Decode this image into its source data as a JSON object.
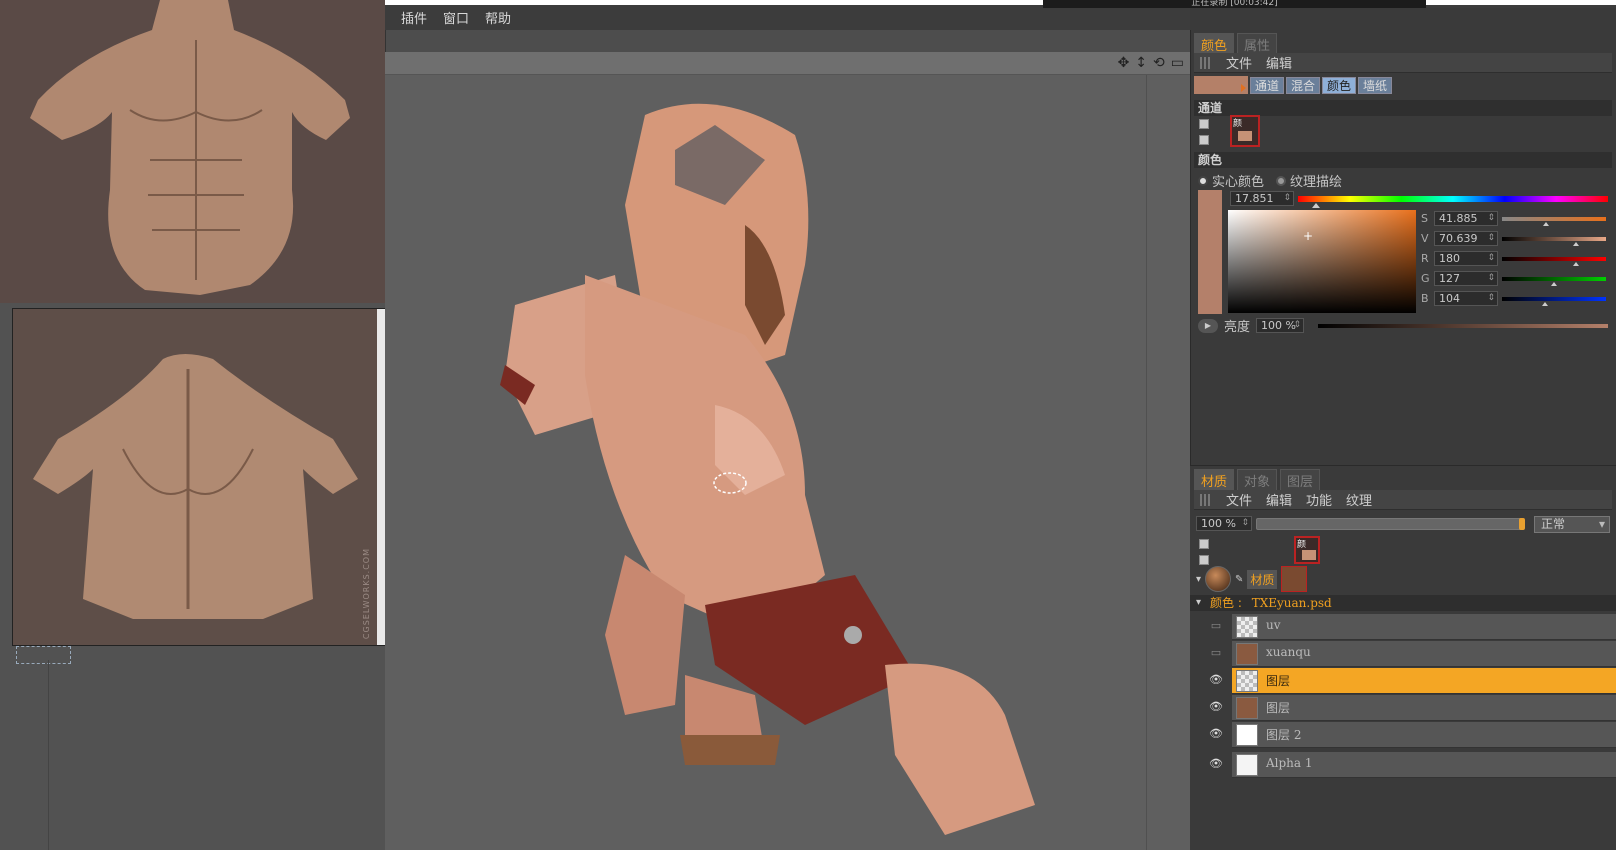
{
  "menu": {
    "items": [
      "插件",
      "窗口",
      "帮助"
    ]
  },
  "recording": {
    "text": "正在录制 [00:03:42]"
  },
  "reference": {
    "watermark": "CGSELWORKS.COM"
  },
  "right_panel": {
    "tabs": [
      "颜色",
      "属性"
    ],
    "menu": [
      "文件",
      "编辑"
    ],
    "modes": [
      "通道",
      "混合",
      "颜色",
      "墙纸"
    ],
    "channel_section": "通道",
    "channel_thumb_label": "颜",
    "color_section": "颜色",
    "radio_solid": "实心颜色",
    "radio_texture": "纹理描绘",
    "hue": "17.851",
    "sliders": [
      {
        "label": "S",
        "value": "41.885",
        "pos": 0.42,
        "gradient": "#888,#e8701c"
      },
      {
        "label": "V",
        "value": "70.639",
        "pos": 0.71,
        "gradient": "#000,#e8a888"
      },
      {
        "label": "R",
        "value": "180",
        "pos": 0.71,
        "gradient": "#000,#ff0000"
      },
      {
        "label": "G",
        "value": "127",
        "pos": 0.5,
        "gradient": "#000,#00d000"
      },
      {
        "label": "B",
        "value": "104",
        "pos": 0.41,
        "gradient": "#000,#0033ff"
      }
    ],
    "brightness_label": "亮度",
    "brightness_value": "100 %"
  },
  "material_panel": {
    "tabs": [
      "材质",
      "对象",
      "图层"
    ],
    "menu": [
      "文件",
      "编辑",
      "功能",
      "纹理"
    ],
    "opacity": "100 %",
    "blend_mode": "正常",
    "material_tag": "材质",
    "color_label": "颜色",
    "file_name": "TXEyuan.psd",
    "layers": [
      {
        "name": "uv",
        "visible": false,
        "selected": false,
        "thumb": "checker"
      },
      {
        "name": "xuanqu",
        "visible": false,
        "selected": false,
        "thumb": "texture"
      },
      {
        "name": "图层",
        "visible": true,
        "selected": true,
        "thumb": "checker"
      },
      {
        "name": "图层",
        "visible": true,
        "selected": false,
        "thumb": "texture"
      },
      {
        "name": "图层 2",
        "visible": true,
        "selected": false,
        "thumb": "white"
      },
      {
        "name": "Alpha 1",
        "visible": true,
        "selected": false,
        "thumb": "alpha"
      }
    ]
  },
  "colors": {
    "accent": "#f0a020",
    "selected_layer": "#f4a624",
    "skin": "#b4806a"
  }
}
